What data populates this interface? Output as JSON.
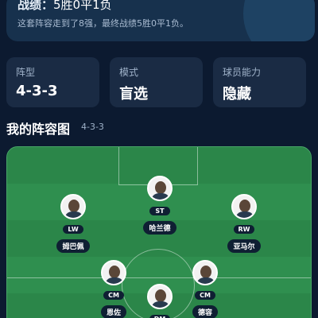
{
  "summary": {
    "record_label": "战绩：",
    "record_value": "5胜0平1负",
    "description": "这套阵容走到了8强，最终战绩5胜0平1负。"
  },
  "stats": [
    {
      "label": "阵型",
      "value": "4-3-3"
    },
    {
      "label": "模式",
      "value": "盲选"
    },
    {
      "label": "球员能力",
      "value": "隐藏"
    }
  ],
  "lineup": {
    "title": "我的阵容图",
    "formation": "4-3-3"
  },
  "players": [
    {
      "position": "ST",
      "name": "哈兰德"
    },
    {
      "position": "LW",
      "name": "姆巴佩"
    },
    {
      "position": "RW",
      "name": "亚马尔"
    },
    {
      "position": "CM",
      "name": "恩佐"
    },
    {
      "position": "CM",
      "name": "德容"
    },
    {
      "position": "DM",
      "name": ""
    }
  ]
}
